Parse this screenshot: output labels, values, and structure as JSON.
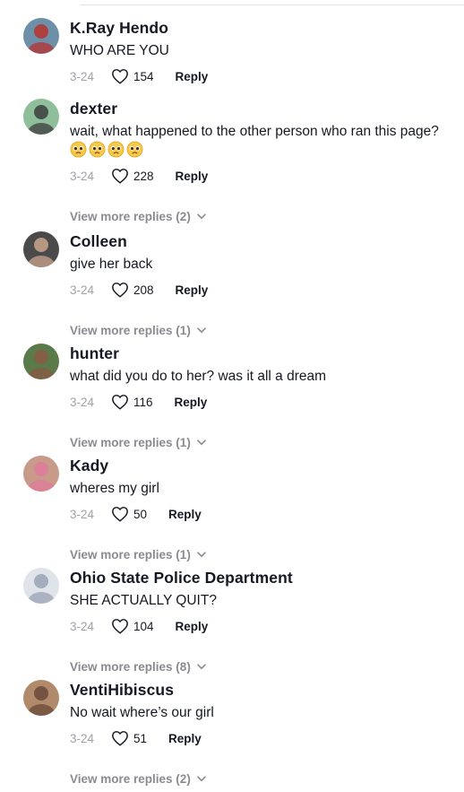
{
  "comments": [
    {
      "username": "K.Ray Hendo",
      "text": "WHO ARE YOU",
      "date": "3-24",
      "likes": "154",
      "reply": "Reply",
      "more": "",
      "avatar_colors": [
        "#6d8fa8",
        "#b7322f"
      ]
    },
    {
      "username": "dexter",
      "text": "wait, what happened to the other person who ran this page?",
      "emoji_count": 4,
      "date": "3-24",
      "likes": "228",
      "reply": "Reply",
      "more": "View more replies (2)",
      "avatar_colors": [
        "#8fbf9a",
        "#3c3c3c"
      ]
    },
    {
      "username": "Colleen",
      "text": "give her back",
      "date": "3-24",
      "likes": "208",
      "reply": "Reply",
      "more": "View more replies (1)",
      "avatar_colors": [
        "#4a4a4a",
        "#c9a58c"
      ]
    },
    {
      "username": "hunter",
      "text": "what did you do to her? was it all a dream",
      "date": "3-24",
      "likes": "116",
      "reply": "Reply",
      "more": "View more replies (1)",
      "avatar_colors": [
        "#5a7a4a",
        "#8b5a44"
      ]
    },
    {
      "username": "Kady",
      "text": "wheres my girl",
      "date": "3-24",
      "likes": "50",
      "reply": "Reply",
      "more": "View more replies (1)",
      "avatar_colors": [
        "#c79a8a",
        "#e07a9a"
      ]
    },
    {
      "username": "Ohio State Police Department",
      "text": "SHE ACTUALLY QUIT?",
      "date": "3-24",
      "likes": "104",
      "reply": "Reply",
      "more": "View more replies (8)",
      "avatar_colors": [
        "#dfe3ea",
        "#9aa3b5"
      ]
    },
    {
      "username": "VentiHibiscus",
      "text": "No wait where’s our girl",
      "date": "3-24",
      "likes": "51",
      "reply": "Reply",
      "more": "View more replies (2)",
      "avatar_colors": [
        "#b08a6a",
        "#6a4a3a"
      ]
    }
  ],
  "icons": {
    "like": "heart-outline-icon",
    "expand": "chevron-down-icon",
    "emoji": "pleading-face-emoji"
  }
}
